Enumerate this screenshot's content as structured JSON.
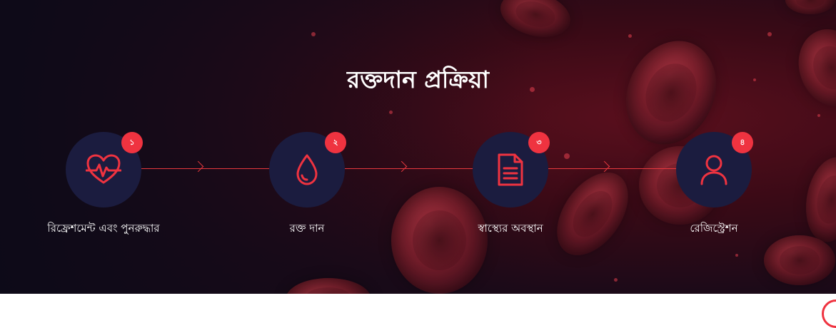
{
  "section": {
    "title": "রক্তদান প্রক্রিয়া"
  },
  "steps": [
    {
      "number": "১",
      "label": "রিফ্রেশমেন্ট এবং পুনরুদ্ধার",
      "icon": "heartbeat-icon"
    },
    {
      "number": "২",
      "label": "রক্ত দান",
      "icon": "blood-drop-icon"
    },
    {
      "number": "৩",
      "label": "স্বাস্থ্যের অবস্থান",
      "icon": "document-icon"
    },
    {
      "number": "৪",
      "label": "রেজিস্ট্রেশন",
      "icon": "user-icon"
    }
  ],
  "colors": {
    "accent": "#ef3340",
    "circle": "#1b1c3f",
    "text": "#ffffff"
  }
}
